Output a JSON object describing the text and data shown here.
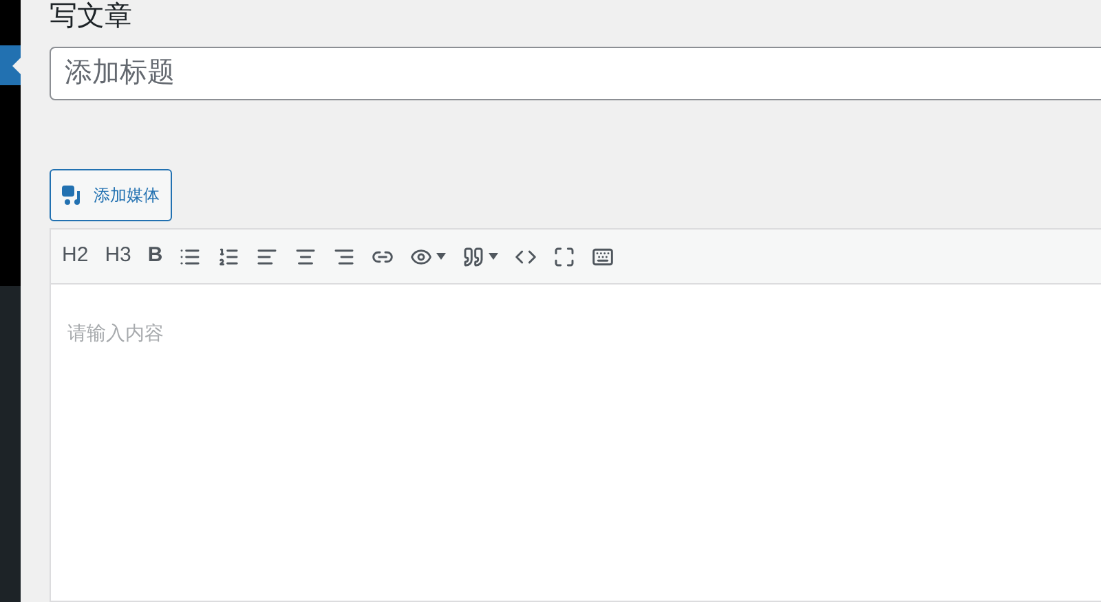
{
  "page": {
    "title": "写文章"
  },
  "title_field": {
    "placeholder": "添加标题"
  },
  "add_media_button": {
    "label": "添加媒体"
  },
  "toolbar": {
    "text_buttons": [
      {
        "label": "H2",
        "bold": false
      },
      {
        "label": "H3",
        "bold": false
      },
      {
        "label": "B",
        "bold": true
      }
    ]
  },
  "editor": {
    "placeholder": "请输入内容"
  }
}
